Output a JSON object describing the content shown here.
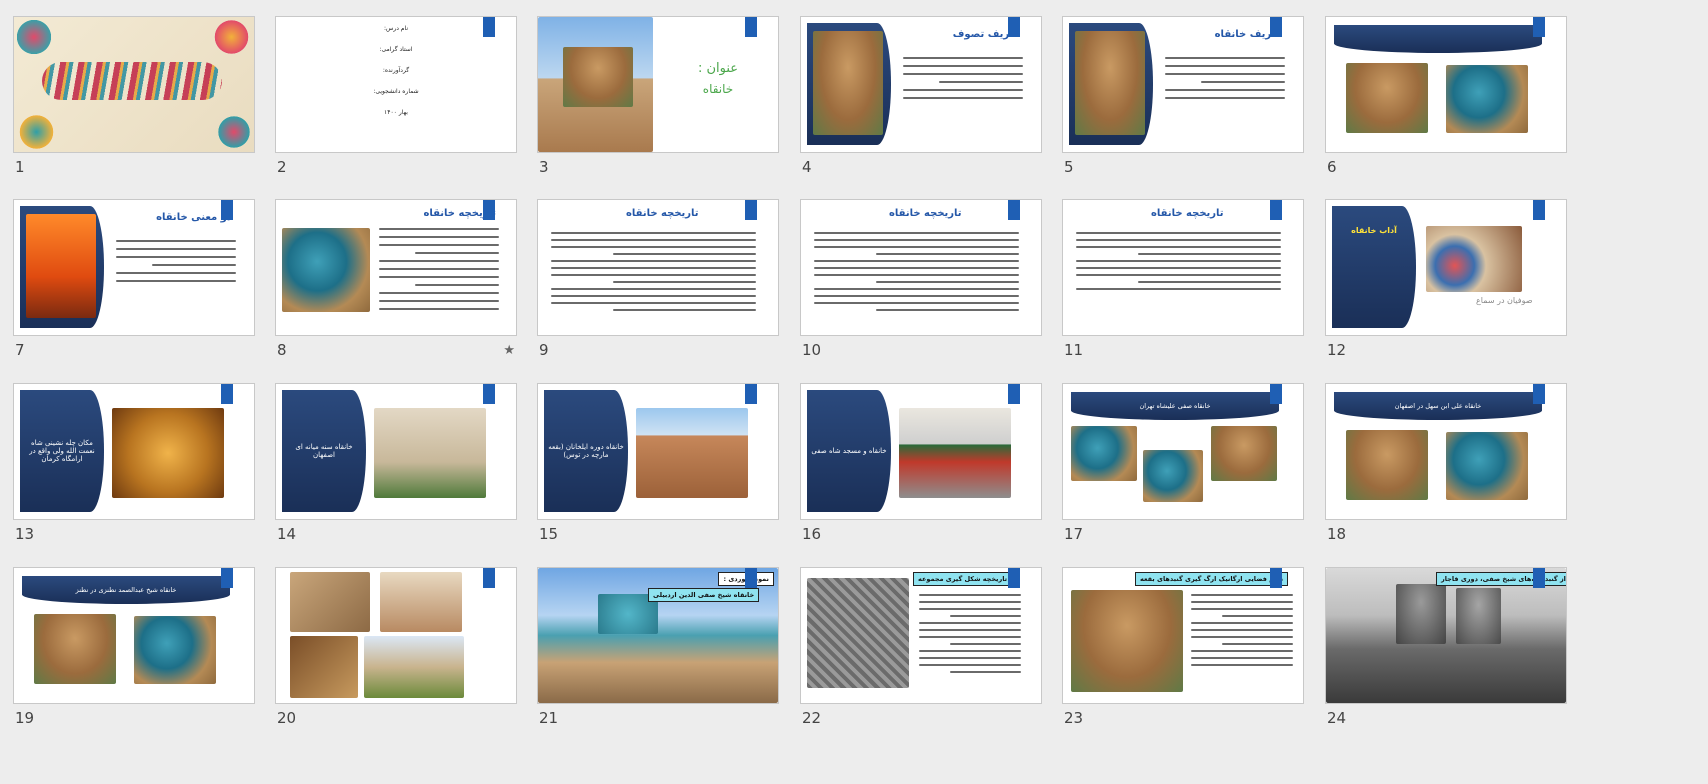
{
  "slides": [
    {
      "number": "1",
      "kind": "calligraphy"
    },
    {
      "number": "2",
      "kind": "info",
      "lines": [
        "نام درس:",
        "استاد گرامی:",
        "گردآورنده:",
        "شماره دانشجویی:",
        "بهار ۱۴۰۰"
      ]
    },
    {
      "number": "3",
      "kind": "title",
      "heading": "عنوان :",
      "subheading": "خانقاه"
    },
    {
      "number": "4",
      "kind": "def",
      "title": "تعریف تصوف"
    },
    {
      "number": "5",
      "kind": "def",
      "title": "تعریف خانقاه"
    },
    {
      "number": "6",
      "kind": "banner2"
    },
    {
      "number": "7",
      "kind": "def",
      "title": "دو معنی خانقاه"
    },
    {
      "number": "8",
      "kind": "history",
      "title": "تاریخچه خانقاه",
      "starred": true
    },
    {
      "number": "9",
      "kind": "text",
      "title": "تاریخچه خانقاه"
    },
    {
      "number": "10",
      "kind": "text",
      "title": "تاریخچه خانقاه"
    },
    {
      "number": "11",
      "kind": "text",
      "title": "تاریخچه خانقاه"
    },
    {
      "number": "12",
      "kind": "adab",
      "title": "آداب خانقاه",
      "caption": "صوفیان در سماع"
    },
    {
      "number": "13",
      "kind": "panelimg",
      "text": "مکان چله نشینی شاه نعمت الله ولی واقع در ارامگاه کرمان"
    },
    {
      "number": "14",
      "kind": "panelimg",
      "text": "خانقاه سنه میانه ای اصفهان"
    },
    {
      "number": "15",
      "kind": "panelimg",
      "text": "خانقاه دوره ایلخانان (بقعه مارچه در توس)"
    },
    {
      "number": "16",
      "kind": "panelimg",
      "text": "خانقاه و مسجد شاه صفی"
    },
    {
      "number": "17",
      "kind": "banner3",
      "text": "خانقاه صفی علیشاه تهران"
    },
    {
      "number": "18",
      "kind": "banner2",
      "text": "خانقاه علی ابن سهل در اصفهان"
    },
    {
      "number": "19",
      "kind": "banner2",
      "text": "خانقاه شیخ عبدالصمد نطنزی در نطنز"
    },
    {
      "number": "20",
      "kind": "collage"
    },
    {
      "number": "21",
      "kind": "photo",
      "labels": [
        "نمونه موردی :",
        "خانقاه شیخ صفی الدین اردبیلی"
      ]
    },
    {
      "number": "22",
      "kind": "photo-text",
      "label": "تاریخچه شکل گیری مجموعه"
    },
    {
      "number": "23",
      "kind": "photo-text",
      "label": "نظم فضایی ارگانیک ارگ گیری گنبدهای بقعه"
    },
    {
      "number": "24",
      "kind": "bw",
      "label": "نمای کلی از گنبدخانه‌های شیخ صفی، دوری قاجار"
    }
  ],
  "colors": {
    "accent": "#1f5fb4",
    "panel": "#1f3a68",
    "label_cyan": "#8fe3f0",
    "background": "#ededed"
  }
}
